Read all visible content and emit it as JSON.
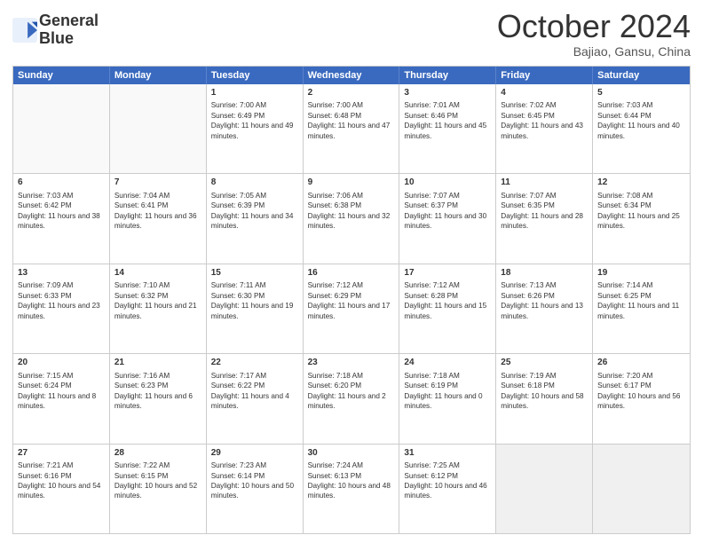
{
  "logo": {
    "line1": "General",
    "line2": "Blue"
  },
  "header": {
    "title": "October 2024",
    "subtitle": "Bajiao, Gansu, China"
  },
  "weekdays": [
    "Sunday",
    "Monday",
    "Tuesday",
    "Wednesday",
    "Thursday",
    "Friday",
    "Saturday"
  ],
  "weeks": [
    [
      {
        "day": "",
        "info": ""
      },
      {
        "day": "",
        "info": ""
      },
      {
        "day": "1",
        "info": "Sunrise: 7:00 AM\nSunset: 6:49 PM\nDaylight: 11 hours and 49 minutes."
      },
      {
        "day": "2",
        "info": "Sunrise: 7:00 AM\nSunset: 6:48 PM\nDaylight: 11 hours and 47 minutes."
      },
      {
        "day": "3",
        "info": "Sunrise: 7:01 AM\nSunset: 6:46 PM\nDaylight: 11 hours and 45 minutes."
      },
      {
        "day": "4",
        "info": "Sunrise: 7:02 AM\nSunset: 6:45 PM\nDaylight: 11 hours and 43 minutes."
      },
      {
        "day": "5",
        "info": "Sunrise: 7:03 AM\nSunset: 6:44 PM\nDaylight: 11 hours and 40 minutes."
      }
    ],
    [
      {
        "day": "6",
        "info": "Sunrise: 7:03 AM\nSunset: 6:42 PM\nDaylight: 11 hours and 38 minutes."
      },
      {
        "day": "7",
        "info": "Sunrise: 7:04 AM\nSunset: 6:41 PM\nDaylight: 11 hours and 36 minutes."
      },
      {
        "day": "8",
        "info": "Sunrise: 7:05 AM\nSunset: 6:39 PM\nDaylight: 11 hours and 34 minutes."
      },
      {
        "day": "9",
        "info": "Sunrise: 7:06 AM\nSunset: 6:38 PM\nDaylight: 11 hours and 32 minutes."
      },
      {
        "day": "10",
        "info": "Sunrise: 7:07 AM\nSunset: 6:37 PM\nDaylight: 11 hours and 30 minutes."
      },
      {
        "day": "11",
        "info": "Sunrise: 7:07 AM\nSunset: 6:35 PM\nDaylight: 11 hours and 28 minutes."
      },
      {
        "day": "12",
        "info": "Sunrise: 7:08 AM\nSunset: 6:34 PM\nDaylight: 11 hours and 25 minutes."
      }
    ],
    [
      {
        "day": "13",
        "info": "Sunrise: 7:09 AM\nSunset: 6:33 PM\nDaylight: 11 hours and 23 minutes."
      },
      {
        "day": "14",
        "info": "Sunrise: 7:10 AM\nSunset: 6:32 PM\nDaylight: 11 hours and 21 minutes."
      },
      {
        "day": "15",
        "info": "Sunrise: 7:11 AM\nSunset: 6:30 PM\nDaylight: 11 hours and 19 minutes."
      },
      {
        "day": "16",
        "info": "Sunrise: 7:12 AM\nSunset: 6:29 PM\nDaylight: 11 hours and 17 minutes."
      },
      {
        "day": "17",
        "info": "Sunrise: 7:12 AM\nSunset: 6:28 PM\nDaylight: 11 hours and 15 minutes."
      },
      {
        "day": "18",
        "info": "Sunrise: 7:13 AM\nSunset: 6:26 PM\nDaylight: 11 hours and 13 minutes."
      },
      {
        "day": "19",
        "info": "Sunrise: 7:14 AM\nSunset: 6:25 PM\nDaylight: 11 hours and 11 minutes."
      }
    ],
    [
      {
        "day": "20",
        "info": "Sunrise: 7:15 AM\nSunset: 6:24 PM\nDaylight: 11 hours and 8 minutes."
      },
      {
        "day": "21",
        "info": "Sunrise: 7:16 AM\nSunset: 6:23 PM\nDaylight: 11 hours and 6 minutes."
      },
      {
        "day": "22",
        "info": "Sunrise: 7:17 AM\nSunset: 6:22 PM\nDaylight: 11 hours and 4 minutes."
      },
      {
        "day": "23",
        "info": "Sunrise: 7:18 AM\nSunset: 6:20 PM\nDaylight: 11 hours and 2 minutes."
      },
      {
        "day": "24",
        "info": "Sunrise: 7:18 AM\nSunset: 6:19 PM\nDaylight: 11 hours and 0 minutes."
      },
      {
        "day": "25",
        "info": "Sunrise: 7:19 AM\nSunset: 6:18 PM\nDaylight: 10 hours and 58 minutes."
      },
      {
        "day": "26",
        "info": "Sunrise: 7:20 AM\nSunset: 6:17 PM\nDaylight: 10 hours and 56 minutes."
      }
    ],
    [
      {
        "day": "27",
        "info": "Sunrise: 7:21 AM\nSunset: 6:16 PM\nDaylight: 10 hours and 54 minutes."
      },
      {
        "day": "28",
        "info": "Sunrise: 7:22 AM\nSunset: 6:15 PM\nDaylight: 10 hours and 52 minutes."
      },
      {
        "day": "29",
        "info": "Sunrise: 7:23 AM\nSunset: 6:14 PM\nDaylight: 10 hours and 50 minutes."
      },
      {
        "day": "30",
        "info": "Sunrise: 7:24 AM\nSunset: 6:13 PM\nDaylight: 10 hours and 48 minutes."
      },
      {
        "day": "31",
        "info": "Sunrise: 7:25 AM\nSunset: 6:12 PM\nDaylight: 10 hours and 46 minutes."
      },
      {
        "day": "",
        "info": ""
      },
      {
        "day": "",
        "info": ""
      }
    ]
  ]
}
